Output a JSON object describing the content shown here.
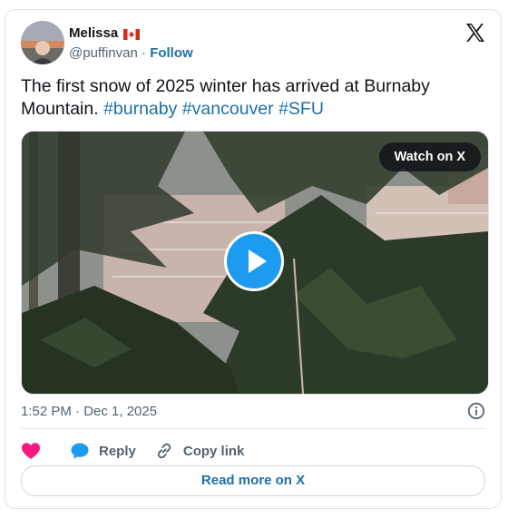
{
  "author": {
    "name": "Melissa",
    "flag": "canada-flag",
    "handle": "@puffinvan",
    "separator": "·",
    "follow_label": "Follow"
  },
  "platform_logo": "x-logo",
  "tweet": {
    "text": "The first snow of 2025 winter has arrived at Burnaby Mountain.",
    "hashtags": [
      "#burnaby",
      "#vancouver",
      "#SFU"
    ]
  },
  "media": {
    "watch_label": "Watch on X",
    "play_icon": "play-icon"
  },
  "timestamp": "1:52 PM · Dec 1, 2025",
  "actions": {
    "like_icon": "heart-icon",
    "reply_label": "Reply",
    "copy_label": "Copy link"
  },
  "read_more_label": "Read more on X",
  "colors": {
    "link": "#1d6fa5",
    "heart": "#f91880",
    "reply_bubble": "#1d9bf0",
    "play_button": "#1d9bf0"
  }
}
